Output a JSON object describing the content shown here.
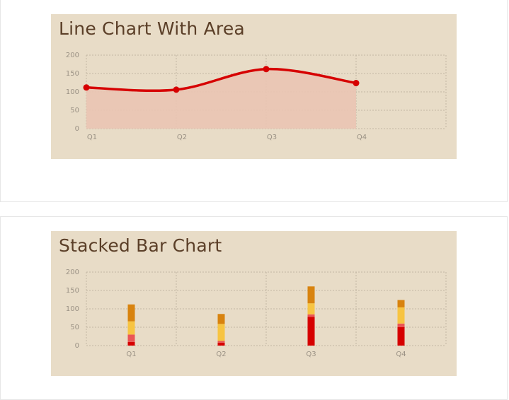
{
  "charts": {
    "area": {
      "title": "Line Chart With Area"
    },
    "stacked": {
      "title": "Stacked Bar Chart"
    }
  },
  "chart_data": [
    {
      "type": "area",
      "title": "Line Chart With Area",
      "categories": [
        "Q1",
        "Q2",
        "Q3",
        "Q4"
      ],
      "series": [
        {
          "values": [
            112,
            106,
            162,
            124
          ]
        }
      ],
      "yticks": [
        0,
        50,
        100,
        150,
        200
      ],
      "ylim": [
        0,
        200
      ],
      "grid": true,
      "colors": {
        "line": "#d60000",
        "fill": "#eac4b3"
      }
    },
    {
      "type": "bar",
      "stacked": true,
      "title": "Stacked Bar Chart",
      "categories": [
        "Q1",
        "Q2",
        "Q3",
        "Q4"
      ],
      "series": [
        {
          "values": [
            10,
            8,
            78,
            50
          ],
          "color": "#d60000"
        },
        {
          "values": [
            20,
            5,
            7,
            10
          ],
          "color": "#ea5656"
        },
        {
          "values": [
            36,
            46,
            30,
            44
          ],
          "color": "#f7c442"
        },
        {
          "values": [
            46,
            27,
            46,
            20
          ],
          "color": "#d8830f"
        }
      ],
      "yticks": [
        0,
        50,
        100,
        150,
        200
      ],
      "ylim": [
        0,
        200
      ],
      "grid": true
    }
  ]
}
